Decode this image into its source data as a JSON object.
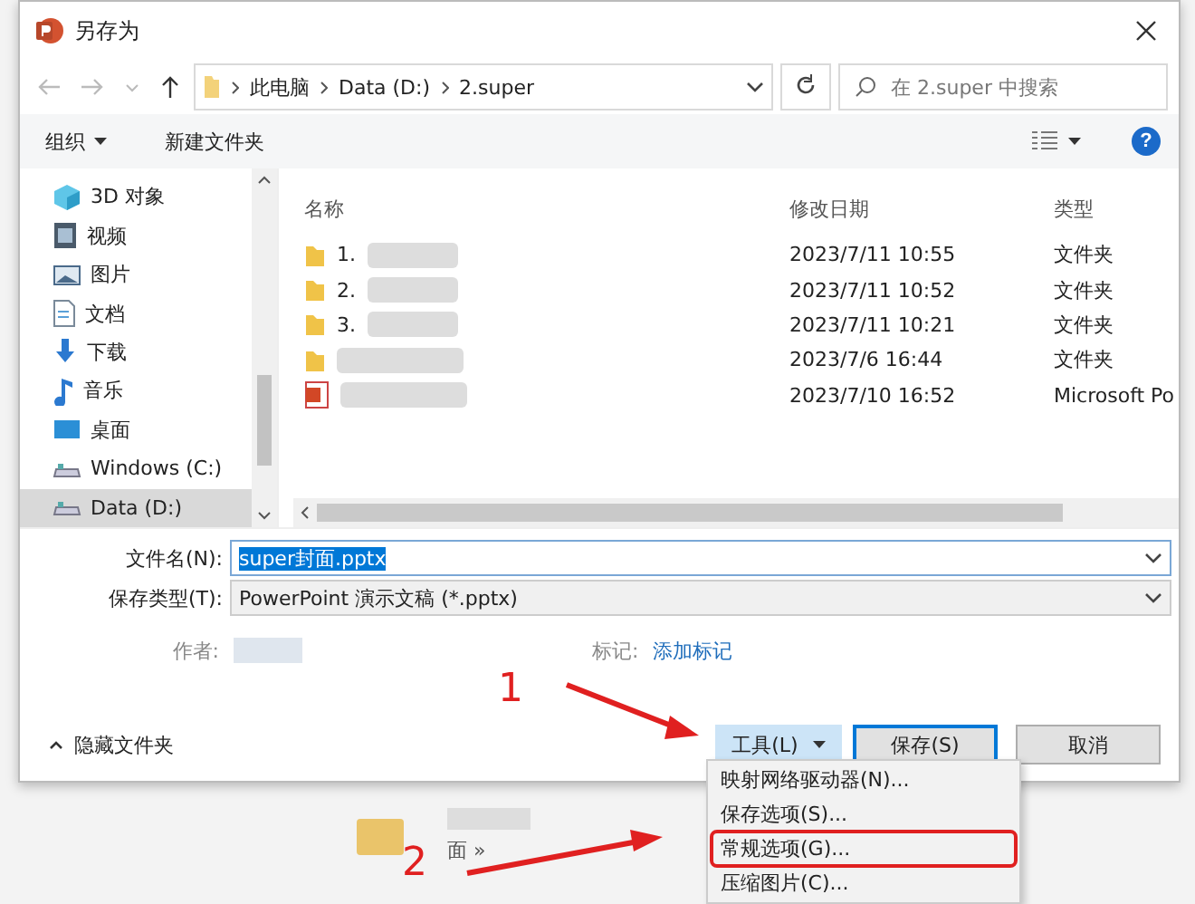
{
  "window": {
    "title": "另存为"
  },
  "address": {
    "crumbs": [
      "此电脑",
      "Data (D:)",
      "2.super"
    ],
    "search_placeholder": "在 2.super 中搜索"
  },
  "toolbar": {
    "organize": "组织",
    "new_folder": "新建文件夹",
    "help": "?"
  },
  "sidebar": {
    "items": [
      {
        "label": "3D 对象",
        "kind": "cube",
        "selected": false
      },
      {
        "label": "视频",
        "kind": "film",
        "selected": false
      },
      {
        "label": "图片",
        "kind": "picture",
        "selected": false
      },
      {
        "label": "文档",
        "kind": "document",
        "selected": false
      },
      {
        "label": "下载",
        "kind": "download",
        "selected": false
      },
      {
        "label": "音乐",
        "kind": "music",
        "selected": false
      },
      {
        "label": "桌面",
        "kind": "desktop",
        "selected": false
      },
      {
        "label": "Windows (C:)",
        "kind": "drive",
        "selected": false
      },
      {
        "label": "Data (D:)",
        "kind": "drive",
        "selected": true
      }
    ]
  },
  "table": {
    "columns": [
      "名称",
      "修改日期",
      "类型"
    ],
    "rows": [
      {
        "kind": "folder",
        "name": "1.",
        "date": "2023/7/11 10:55",
        "type": "文件夹"
      },
      {
        "kind": "folder",
        "name": "2.",
        "date": "2023/7/11 10:52",
        "type": "文件夹"
      },
      {
        "kind": "folder",
        "name": "3.",
        "date": "2023/7/11 10:21",
        "type": "文件夹"
      },
      {
        "kind": "folder",
        "date": "2023/7/6 16:44",
        "type": "文件夹"
      },
      {
        "kind": "pptx",
        "date": "2023/7/10 16:52",
        "type": "Microsoft Po"
      }
    ]
  },
  "form": {
    "filename_label": "文件名(N):",
    "filename": "super封面.pptx",
    "type_label": "保存类型(T):",
    "type": "PowerPoint 演示文稿 (*.pptx)",
    "author_label": "作者:",
    "tags_label": "标记:",
    "tags_link": "添加标记"
  },
  "footer": {
    "hide_folders": "隐藏文件夹",
    "buttons": [
      {
        "label": "工具(L)",
        "kind": "menu"
      },
      {
        "label": "保存(S)",
        "kind": "default"
      },
      {
        "label": "取消",
        "kind": "plain"
      }
    ]
  },
  "menu": {
    "items": [
      {
        "label": "映射网络驱动器(N)...",
        "annotated": false
      },
      {
        "label": "保存选项(S)...",
        "annotated": false
      },
      {
        "label": "常规选项(G)...",
        "annotated": true
      },
      {
        "label": "压缩图片(C)...",
        "annotated": false
      }
    ]
  },
  "background": {
    "breadcrumb": "面 »"
  },
  "annotations": [
    {
      "label": "1"
    },
    {
      "label": "2"
    }
  ]
}
